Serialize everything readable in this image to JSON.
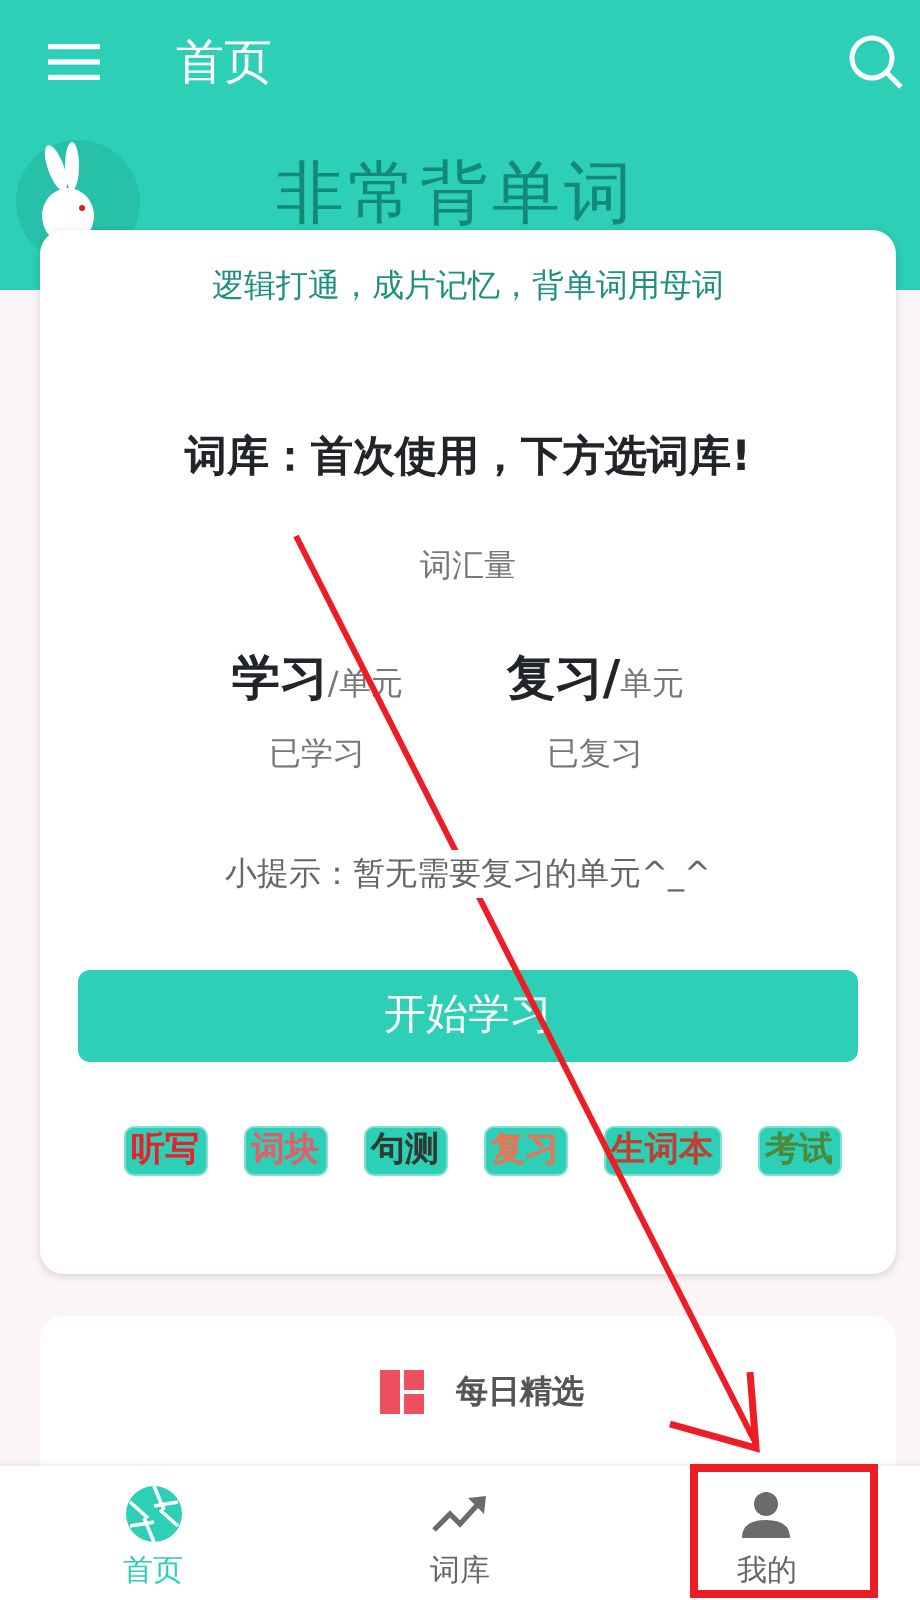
{
  "app_bar": {
    "title": "首页"
  },
  "banner": {
    "title": "非常背单词"
  },
  "main_card": {
    "slogan": "逻辑打通，成片记忆，背单词用母词",
    "headline": "词库：首次使用，下方选词库!",
    "vocab_label": "词汇量",
    "stats": [
      {
        "title": "学习",
        "unit": "/单元",
        "caption": "已学习"
      },
      {
        "title": "复习/",
        "unit": "单元",
        "caption": "已复习"
      }
    ],
    "hint": "小提示：暂无需要复习的单元^_^",
    "start_button": "开始学习",
    "tags": [
      {
        "label": "听写"
      },
      {
        "label": "词块"
      },
      {
        "label": "句测"
      },
      {
        "label": "复习"
      },
      {
        "label": "生词本"
      },
      {
        "label": "考试"
      }
    ]
  },
  "daily_card": {
    "title": "每日精选"
  },
  "bottom_nav": [
    {
      "label": "首页",
      "selected": true
    },
    {
      "label": "词库",
      "selected": false
    },
    {
      "label": "我的",
      "selected": false
    }
  ]
}
